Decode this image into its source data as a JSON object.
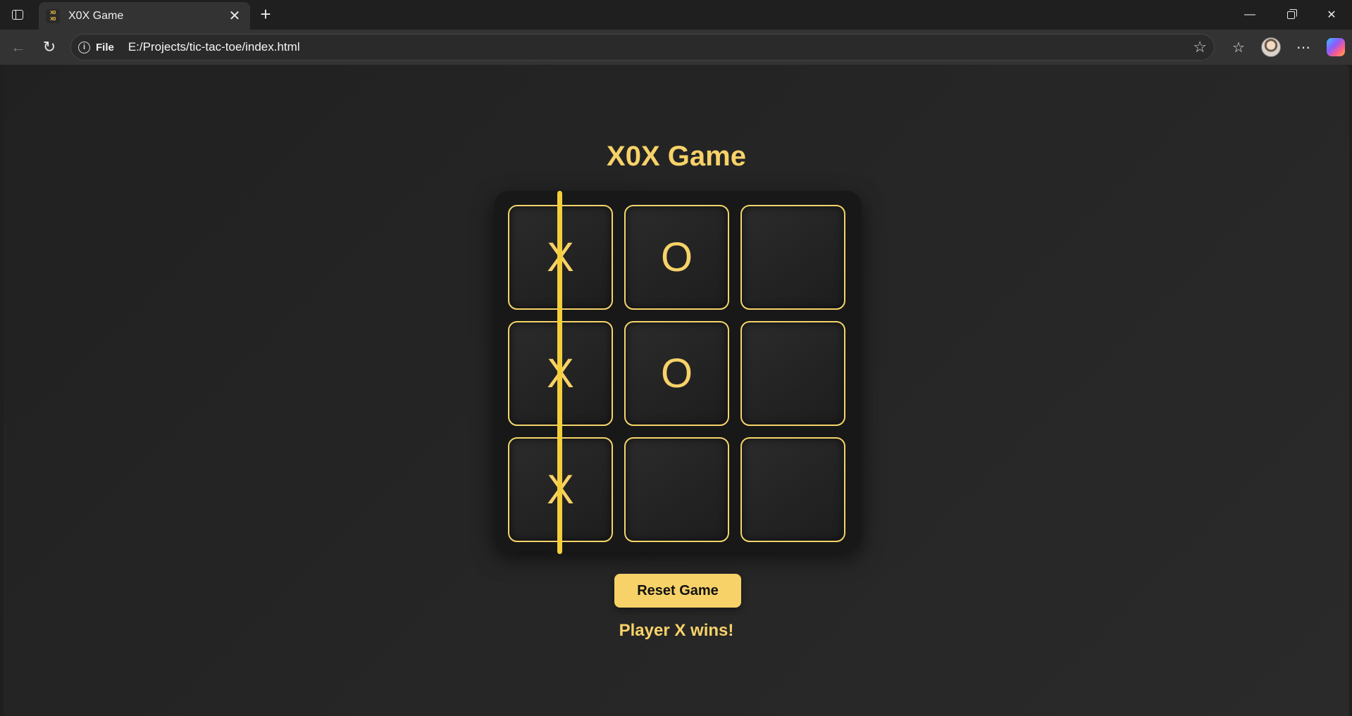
{
  "browser": {
    "tab_title": "X0X Game",
    "favicon_text": "X0 X0",
    "address_scheme": "File",
    "url": "E:/Projects/tic-tac-toe/index.html"
  },
  "game": {
    "title": "X0X Game",
    "cells": [
      "X",
      "O",
      "",
      "X",
      "O",
      "",
      "X",
      "",
      ""
    ],
    "winning_line": "left column",
    "reset_label": "Reset Game",
    "status": "Player X wins!",
    "accent_color": "#f7d268"
  }
}
